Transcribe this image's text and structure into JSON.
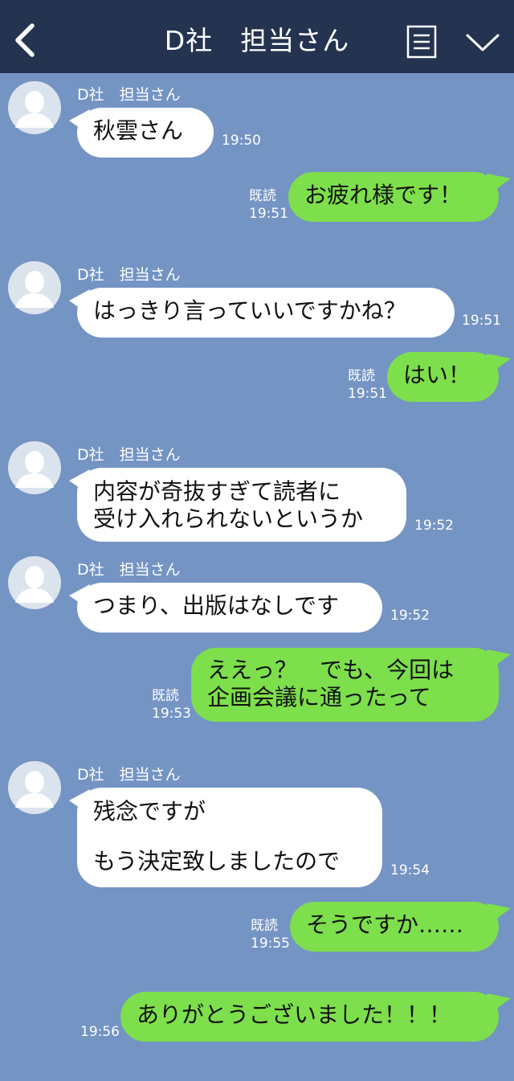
{
  "header": {
    "title": "D社　担当さん",
    "back_icon": "chevron-left-icon",
    "menu_icon": "list-menu-icon",
    "collapse_icon": "chevron-down-icon"
  },
  "colors": {
    "background": "#7494c4",
    "header": "#243350",
    "incoming_bubble": "#ffffff",
    "outgoing_bubble": "#7ddf4b"
  },
  "messages": [
    {
      "direction": "in",
      "sender": "D社　担当さん",
      "lines": [
        "秋雲さん"
      ],
      "time": "19:50"
    },
    {
      "direction": "out",
      "lines": [
        "お疲れ様です！"
      ],
      "read": "既読",
      "time": "19:51"
    },
    {
      "direction": "in",
      "sender": "D社　担当さん",
      "lines": [
        "はっきり言っていいですかね？"
      ],
      "time": "19:51"
    },
    {
      "direction": "out",
      "lines": [
        "はい！"
      ],
      "read": "既読",
      "time": "19:51"
    },
    {
      "direction": "in",
      "sender": "D社　担当さん",
      "lines": [
        "内容が奇抜すぎて読者に",
        "受け入れられないというか"
      ],
      "time": "19:52"
    },
    {
      "direction": "in",
      "sender": "D社　担当さん",
      "lines": [
        "つまり、出版はなしです"
      ],
      "time": "19:52"
    },
    {
      "direction": "out",
      "lines": [
        "ええっ？　でも、今回は",
        "企画会議に通ったって"
      ],
      "read": "既読",
      "time": "19:53"
    },
    {
      "direction": "in",
      "sender": "D社　担当さん",
      "lines": [
        "残念ですが",
        "もう決定致しましたので"
      ],
      "time": "19:54"
    },
    {
      "direction": "out",
      "lines": [
        "そうですか……"
      ],
      "read": "既読",
      "time": "19:55"
    },
    {
      "direction": "out",
      "lines": [
        "ありがとうございました！！！"
      ],
      "time": "19:56"
    }
  ]
}
